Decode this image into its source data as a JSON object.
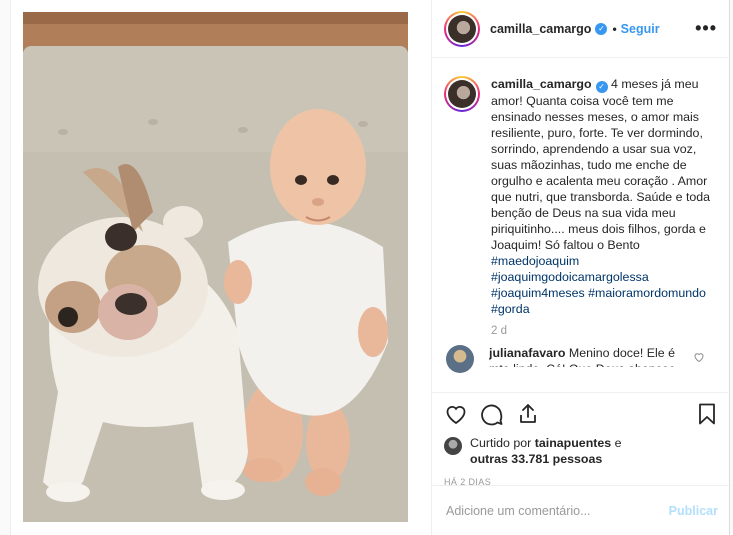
{
  "header": {
    "username": "camilla_camargo",
    "follow_label": "Seguir",
    "more_label": "•••"
  },
  "caption": {
    "username": "camilla_camargo",
    "text": "4 meses já meu amor! Quanta coisa você tem me ensinado nesses meses, o amor mais resiliente, puro, forte. Te ver dormindo, sorrindo, aprendendo a usar sua voz, suas mãozinhas, tudo me enche de orgulho e acalenta meu coração . Amor que nutri, que transborda. Saúde e toda benção de Deus na sua vida meu piriquitinho.... meus dois filhos, gorda e Joaquim! Só faltou o Bento ",
    "hashtags": [
      "#maedojoaquim",
      "#joaquimgodoicamargolessa",
      "#joaquim4meses",
      "#maioramordomundo",
      "#gorda"
    ],
    "time_ago": "2 d"
  },
  "comment": {
    "username": "julianafavaro",
    "text": "Menino doce! Ele é mto lindo. Cá! Que Deus abençoe"
  },
  "likes": {
    "prefix": "Curtido por ",
    "user": "tainapuentes",
    "middle": " e",
    "others": "outras 33.781 pessoas"
  },
  "date": "HÁ 2 DIAS",
  "add_comment": {
    "placeholder": "Adicione um comentário...",
    "publish_label": "Publicar"
  },
  "icons": {
    "like": "heart-icon",
    "comment": "comment-icon",
    "share": "share-icon",
    "save": "bookmark-icon",
    "verified": "verified-badge-icon"
  },
  "colors": {
    "link": "#3897f0",
    "hashtag": "#003569",
    "muted": "#999999",
    "publish_disabled": "#b2dffc"
  }
}
